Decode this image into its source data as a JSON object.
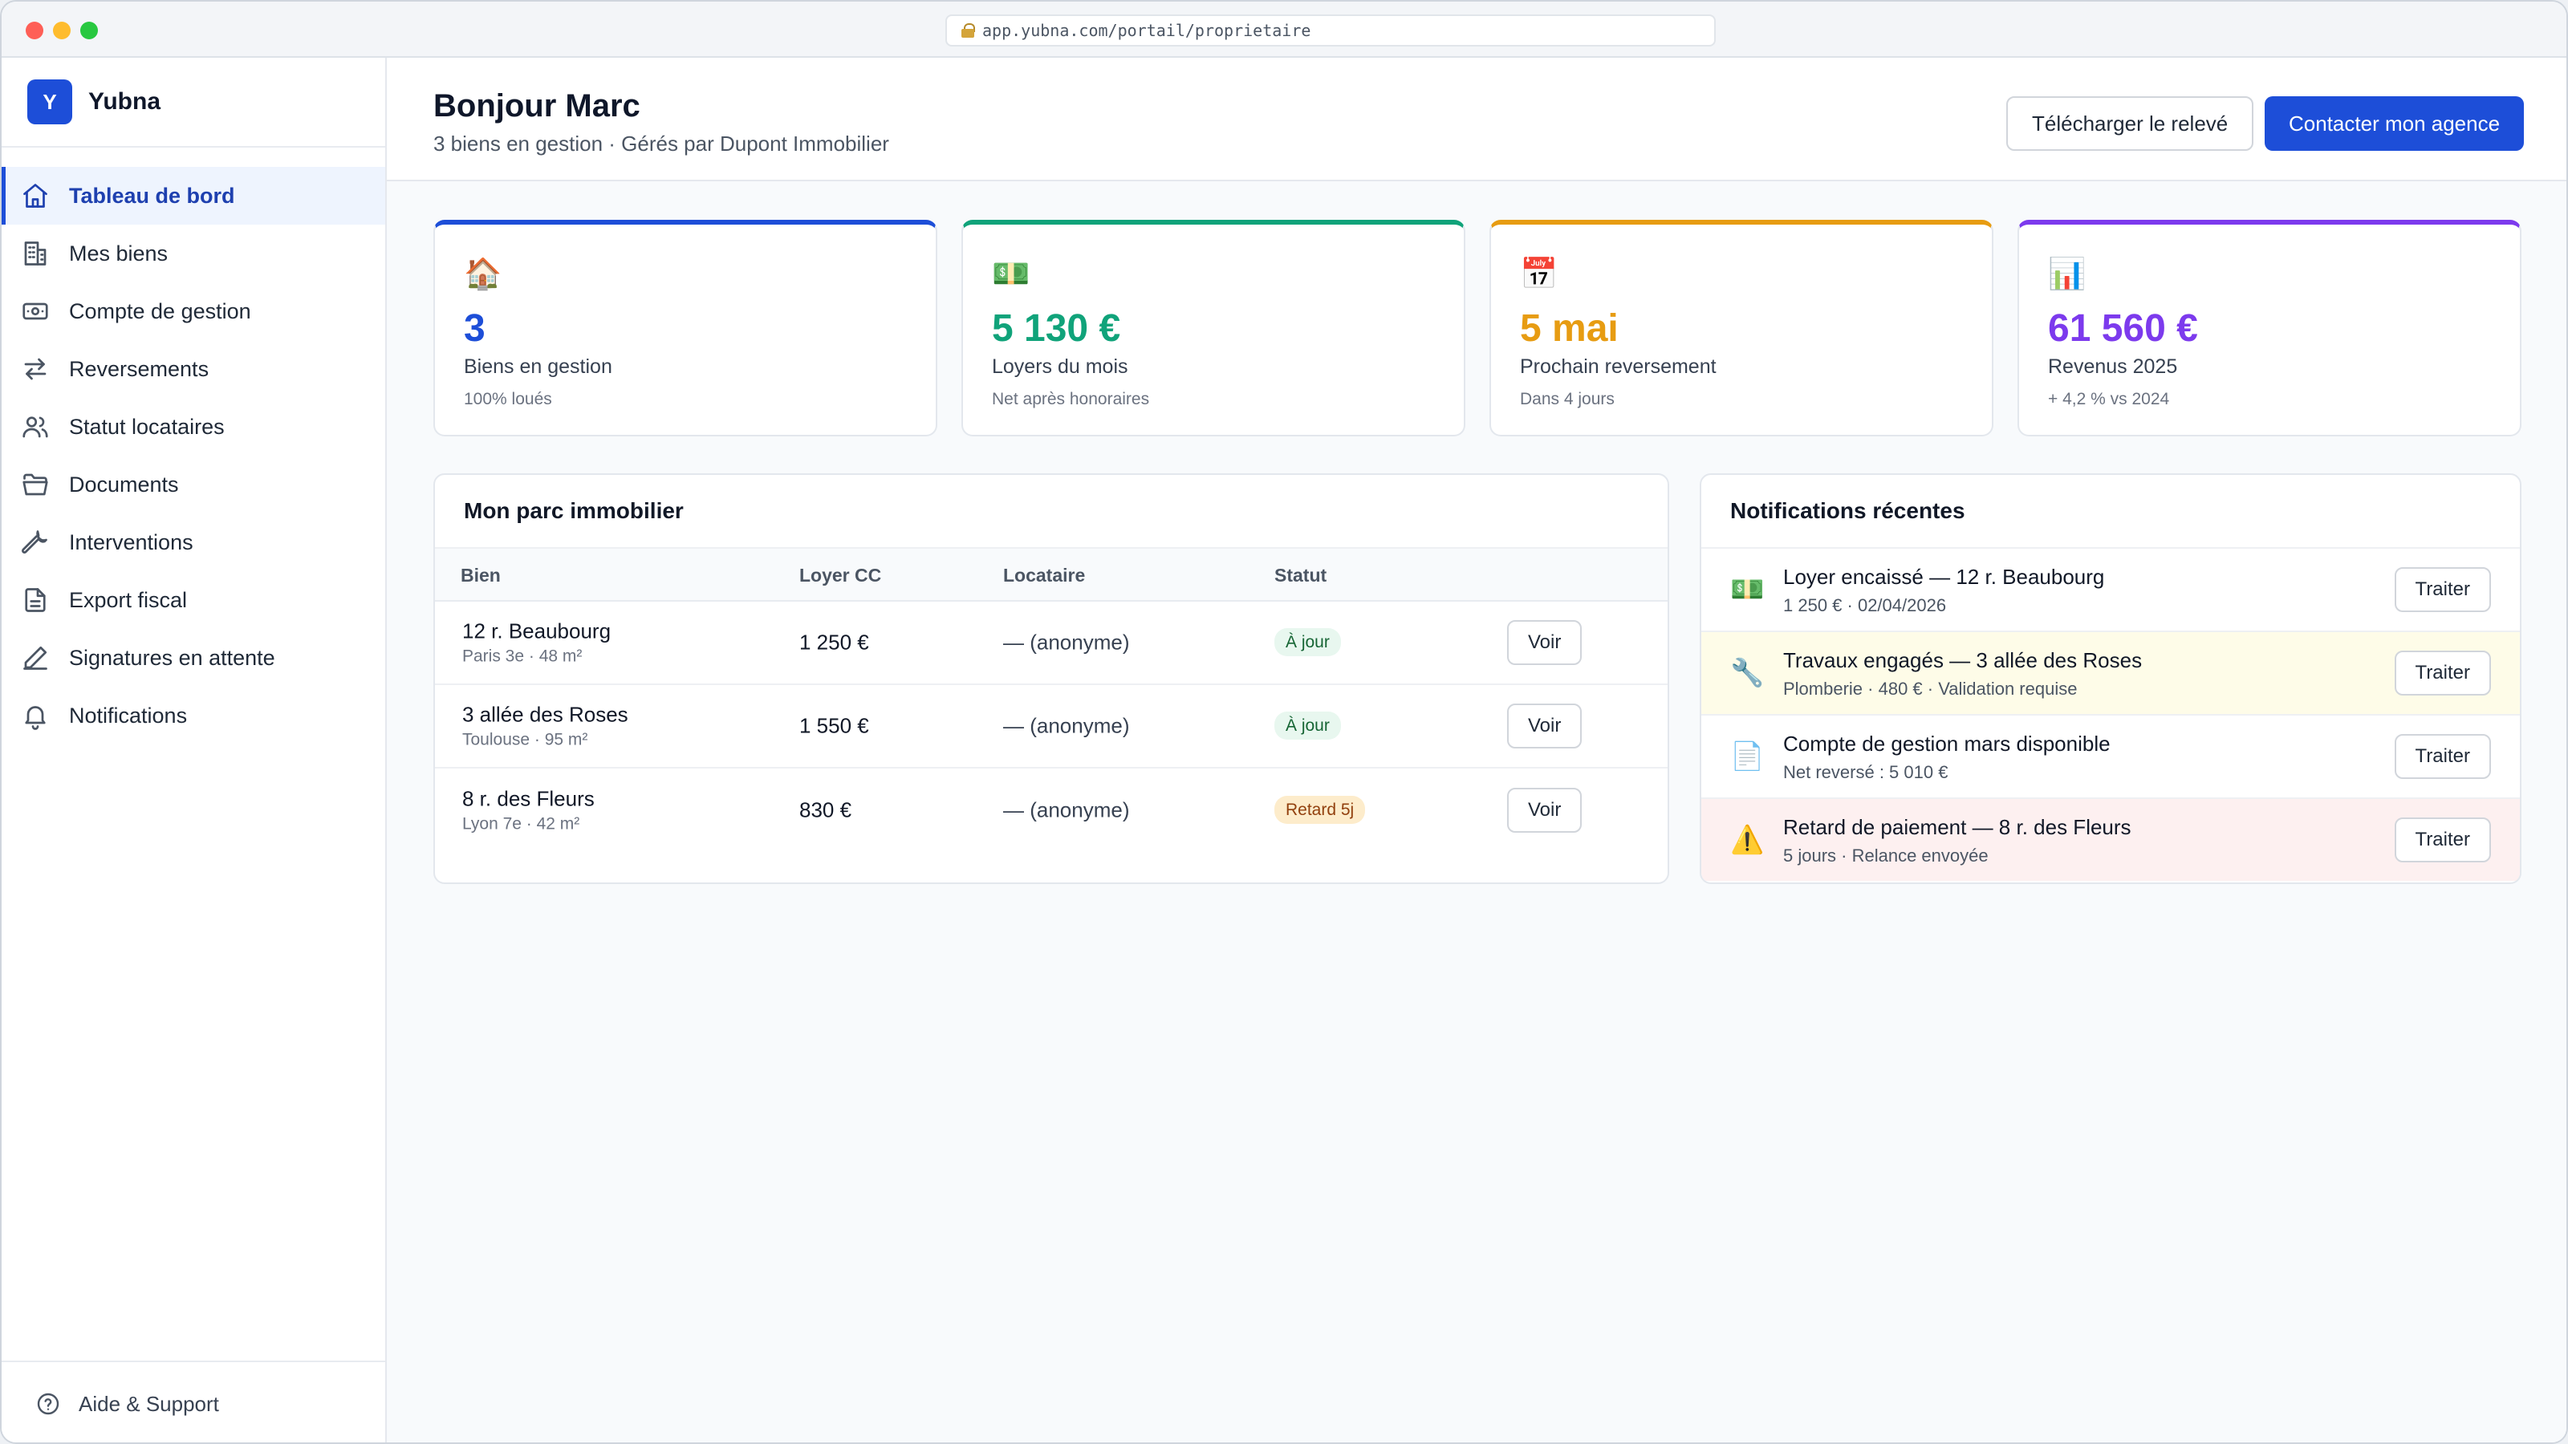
{
  "browser": {
    "url": "app.yubna.com/portail/proprietaire"
  },
  "brand": {
    "logo_letter": "Y",
    "name": "Yubna"
  },
  "sidebar": {
    "items": [
      {
        "label": "Tableau de bord",
        "icon": "home-icon",
        "active": true
      },
      {
        "label": "Mes biens",
        "icon": "building-icon"
      },
      {
        "label": "Compte de gestion",
        "icon": "banknote-icon"
      },
      {
        "label": "Reversements",
        "icon": "arrows-exchange-icon"
      },
      {
        "label": "Statut locataires",
        "icon": "users-icon"
      },
      {
        "label": "Documents",
        "icon": "folder-icon"
      },
      {
        "label": "Interventions",
        "icon": "wrench-icon"
      },
      {
        "label": "Export fiscal",
        "icon": "file-icon"
      },
      {
        "label": "Signatures en attente",
        "icon": "pen-icon"
      },
      {
        "label": "Notifications",
        "icon": "bell-icon"
      }
    ],
    "help_label": "Aide & Support"
  },
  "header": {
    "greeting": "Bonjour Marc",
    "subtitle": "3 biens en gestion · Gérés par Dupont Immobilier",
    "download_label": "Télécharger le relevé",
    "contact_label": "Contacter mon agence"
  },
  "stats": [
    {
      "icon": "🏠",
      "value": "3",
      "label": "Biens en gestion",
      "hint": "100% loués",
      "color": "#1d4ed8"
    },
    {
      "icon": "💵",
      "value": "5 130 €",
      "label": "Loyers du mois",
      "hint": "Net après honoraires",
      "color": "#10a37a"
    },
    {
      "icon": "📅",
      "value": "5 mai",
      "label": "Prochain reversement",
      "hint": "Dans 4 jours",
      "color": "#e79c12"
    },
    {
      "icon": "📊",
      "value": "61 560 €",
      "label": "Revenus 2025",
      "hint": "+ 4,2 % vs 2024",
      "color": "#7c3aed"
    }
  ],
  "portfolio": {
    "title": "Mon parc immobilier",
    "columns": [
      "Bien",
      "Loyer CC",
      "Locataire",
      "Statut"
    ],
    "rows": [
      {
        "name": "12 r. Beaubourg",
        "sub": "Paris 3e · 48 m²",
        "rent": "1 250 €",
        "tenant": "— (anonyme)",
        "status": "À jour",
        "status_kind": "ok",
        "action": "Voir"
      },
      {
        "name": "3 allée des Roses",
        "sub": "Toulouse · 95 m²",
        "rent": "1 550 €",
        "tenant": "— (anonyme)",
        "status": "À jour",
        "status_kind": "ok",
        "action": "Voir"
      },
      {
        "name": "8 r. des Fleurs",
        "sub": "Lyon 7e · 42 m²",
        "rent": "830 €",
        "tenant": "— (anonyme)",
        "status": "Retard 5j",
        "status_kind": "late",
        "action": "Voir"
      }
    ]
  },
  "notifications": {
    "title": "Notifications récentes",
    "items": [
      {
        "icon": "💵",
        "title": "Loyer encaissé — 12 r. Beaubourg",
        "sub": "1 250 € · 02/04/2026",
        "kind": "normal",
        "action": "Traiter"
      },
      {
        "icon": "🔧",
        "title": "Travaux engagés — 3 allée des Roses",
        "sub": "Plomberie · 480 € · Validation requise",
        "kind": "warn",
        "action": "Traiter"
      },
      {
        "icon": "📄",
        "title": "Compte de gestion mars disponible",
        "sub": "Net reversé : 5 010 €",
        "kind": "normal",
        "action": "Traiter"
      },
      {
        "icon": "⚠️",
        "title": "Retard de paiement — 8 r. des Fleurs",
        "sub": "5 jours · Relance envoyée",
        "kind": "alert",
        "action": "Traiter"
      }
    ]
  }
}
